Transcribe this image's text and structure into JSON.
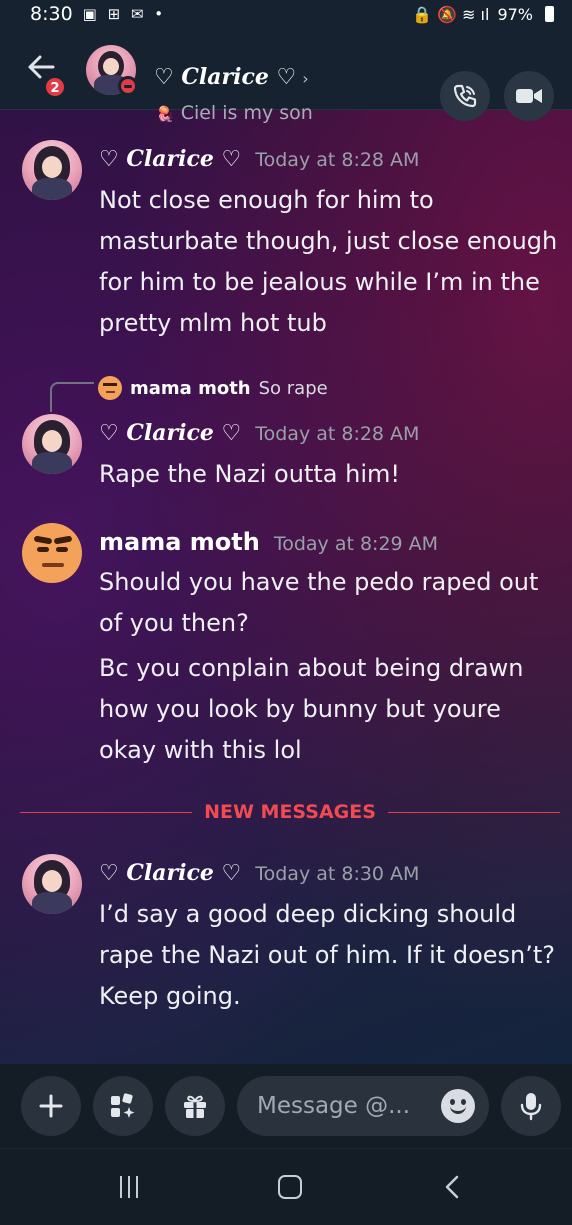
{
  "status_bar": {
    "time": "8:30",
    "icons": "▣ ⊞ ✉ •",
    "battery": "97%",
    "signal": "🔒 🔕 ≋ ıl"
  },
  "header": {
    "back_badge": "2",
    "name": "♡ 𝑪𝒍𝒂𝒓𝒊𝒄𝒆 ♡",
    "chevron": "›",
    "status_emoji": "🪼",
    "status": "Ciel is my son",
    "call_icon": "phone-icon",
    "video_icon": "video-camera-icon"
  },
  "messages": [
    {
      "author": "♡ 𝑪𝒍𝒂𝒓𝒊𝒄𝒆 ♡",
      "time": "Today at 8:28 AM",
      "text": "Not close enough for him to masturbate though, just close enough for him to be jealous while I’m in the pretty mlm hot tub"
    },
    {
      "reply_author": "mama moth",
      "reply_text": "So rape",
      "author": "♡ 𝑪𝒍𝒂𝒓𝒊𝒄𝒆 ♡",
      "time": "Today at 8:28 AM",
      "text": "Rape the Nazi outta him!"
    },
    {
      "author": "mama moth",
      "time": "Today at 8:29 AM",
      "text": "Should you have the pedo raped out of you then?",
      "text2": "Bc you conplain about being drawn how you look by bunny but youre okay with this lol"
    },
    {
      "author": "♡ 𝑪𝒍𝒂𝒓𝒊𝒄𝒆 ♡",
      "time": "Today at 8:30 AM",
      "text": "I’d say a good deep dicking should rape the Nazi out of him.  If it doesn’t?  Keep going."
    }
  ],
  "divider": {
    "label": "NEW MESSAGES",
    "color": "#f04a52"
  },
  "composer": {
    "placeholder": "Message @...",
    "add_icon": "plus-icon",
    "apps_icon": "apps-sparkle-icon",
    "gift_icon": "gift-icon",
    "emoji_icon": "emoji-icon",
    "mic_icon": "microphone-icon"
  },
  "colors": {
    "accent_red": "#e33b45",
    "header_bg": "#172230",
    "composer_bg": "#141c26"
  }
}
